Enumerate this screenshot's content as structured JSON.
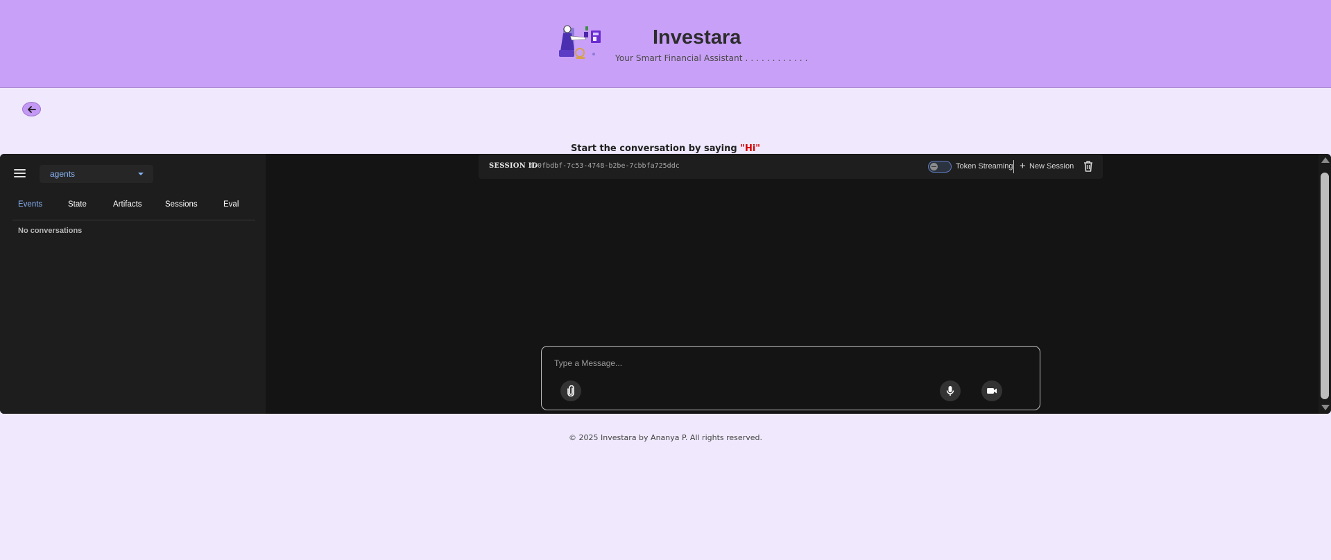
{
  "header": {
    "title": "Investara",
    "subtitle": "Your Smart Financial Assistant . . . . . . . . . . . .",
    "logo_icon": "investor-illustration-icon"
  },
  "nav": {
    "back_icon": "arrow-left-icon"
  },
  "prompt": {
    "text": "Start the conversation by saying ",
    "highlight": "\"Hi\""
  },
  "sidebar": {
    "menu_icon": "hamburger-menu-icon",
    "agent_select": {
      "value": "agents"
    },
    "tabs": [
      {
        "label": "Events",
        "active": true
      },
      {
        "label": "State",
        "active": false
      },
      {
        "label": "Artifacts",
        "active": false
      },
      {
        "label": "Sessions",
        "active": false
      },
      {
        "label": "Eval",
        "active": false
      }
    ],
    "empty_text": "No conversations"
  },
  "session_bar": {
    "label": "SESSION ID",
    "id": "470fbdbf-7c53-4748-b2be-7cbbfa725ddc",
    "token_streaming_label": "Token Streaming",
    "token_streaming_on": false,
    "new_session_label": "New Session",
    "delete_icon": "trash-icon"
  },
  "composer": {
    "placeholder": "Type a Message...",
    "attach_icon": "paperclip-icon",
    "mic_icon": "microphone-icon",
    "video_icon": "video-camera-icon"
  },
  "footer": {
    "text": "© 2025 Investara by Ananya P. All rights reserved."
  },
  "colors": {
    "header_bg": "#c9a0f7",
    "page_bg": "#f0e9fd",
    "app_bg": "#141414",
    "sidebar_bg": "#1d1d1d",
    "accent_blue": "#8ab4f8",
    "highlight_red": "#d50000"
  }
}
